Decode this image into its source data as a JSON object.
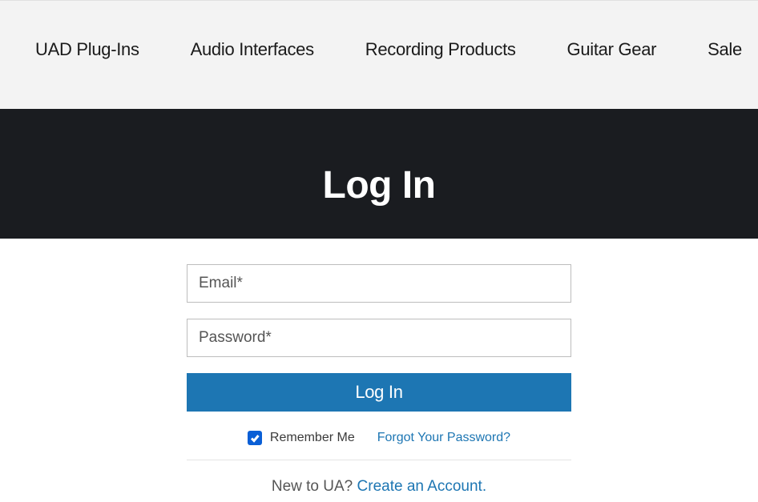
{
  "nav": {
    "items": [
      {
        "label": "UAD Plug-Ins"
      },
      {
        "label": "Audio Interfaces"
      },
      {
        "label": "Recording Products"
      },
      {
        "label": "Guitar Gear"
      },
      {
        "label": "Sale"
      }
    ]
  },
  "hero": {
    "title": "Log In"
  },
  "form": {
    "email_placeholder": "Email*",
    "password_placeholder": "Password*",
    "submit_label": "Log In",
    "remember_label": "Remember Me",
    "remember_checked": true,
    "forgot_label": "Forgot Your Password?",
    "signup_prompt": "New to UA? ",
    "signup_link": "Create an Account."
  }
}
